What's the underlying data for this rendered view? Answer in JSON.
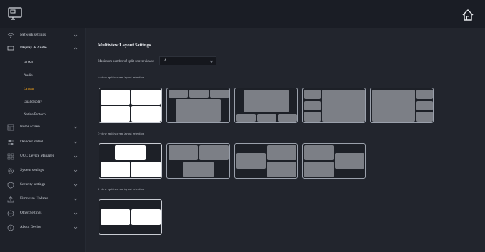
{
  "sidebar": {
    "items": [
      {
        "label": "Network settings",
        "icon": "wifi-icon"
      },
      {
        "label": "Display & Audio",
        "icon": "monitor-icon"
      },
      {
        "label": "Home screen",
        "icon": "home-screen-icon"
      },
      {
        "label": "Device Control",
        "icon": "sliders-icon"
      },
      {
        "label": "UCC Device Manager",
        "icon": "grid-icon"
      },
      {
        "label": "System settings",
        "icon": "gear-icon"
      },
      {
        "label": "Security settings",
        "icon": "shield-icon"
      },
      {
        "label": "Firmware Updates",
        "icon": "upload-icon"
      },
      {
        "label": "Other Settings",
        "icon": "more-icon"
      },
      {
        "label": "About Device",
        "icon": "info-icon"
      }
    ],
    "display_sub_items": [
      "HDMI",
      "Audio",
      "Layout",
      "Dual display",
      "Native Protocol"
    ],
    "active_sub_item": "Layout"
  },
  "main": {
    "title": "Multiview Layout Settings",
    "max_views_label": "Maximum number of split-screen views:",
    "max_views_value": "4",
    "sections": [
      "4-view split-screen layout selection",
      "3-view split-screen layout selection",
      "2-view split-screen layout selection"
    ]
  },
  "colors": {
    "accent": "#f1a21a",
    "selected_block": "#ffffff",
    "block": "#7c7f86"
  }
}
